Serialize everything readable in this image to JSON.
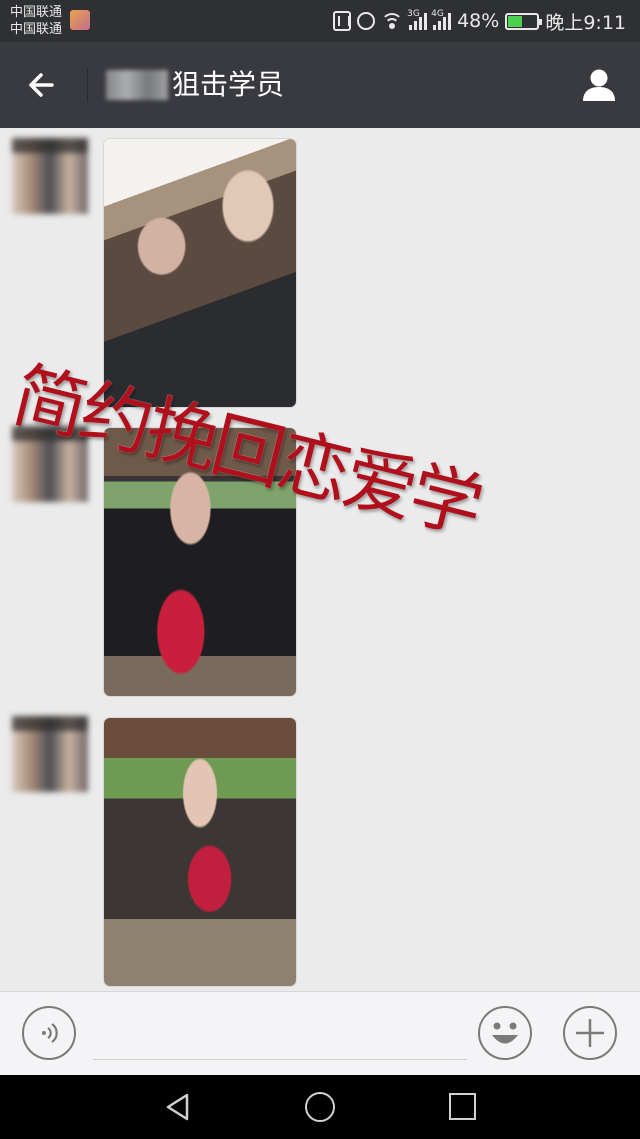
{
  "status_bar": {
    "carrier_1": "中国联通",
    "carrier_2": "中国联通",
    "network_3g": "3G",
    "network_4g": "4G",
    "battery_percent": "48%",
    "battery_level": 0.48,
    "time": "晚上9:11"
  },
  "header": {
    "title": "狙击学员"
  },
  "chat": {
    "messages": [
      {
        "type": "image",
        "direction": "incoming"
      },
      {
        "type": "image",
        "direction": "incoming"
      },
      {
        "type": "image",
        "direction": "incoming"
      }
    ],
    "watermark": "简约挽回恋爱学"
  },
  "icons": {
    "back": "arrow-left-icon",
    "contact": "person-icon",
    "voice": "voice-icon",
    "emoji": "smile-icon",
    "more": "plus-icon"
  },
  "colors": {
    "status_bar": "#2e3033",
    "title_bar": "#393a3f",
    "chat_bg": "#ebebeb",
    "watermark": "#b00f1c"
  }
}
